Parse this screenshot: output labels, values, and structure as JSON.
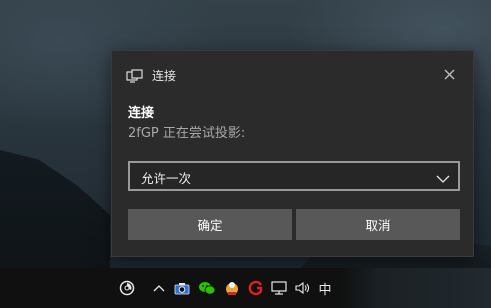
{
  "dialog": {
    "app_title": "连接",
    "heading": "连接",
    "subtext": "2fGP 正在尝试投影:",
    "select_value": "允许一次",
    "ok_label": "确定",
    "cancel_label": "取消",
    "icons": {
      "app": "cast-screen-icon",
      "close": "close-icon",
      "dropdown": "chevron-down-icon"
    }
  },
  "taskbar": {
    "ime_label": "中",
    "tray_icons": [
      "app-swirl-icon",
      "chevron-up-icon",
      "camera-icon",
      "wechat-icon",
      "taskbar-app-icon",
      "red-g-icon",
      "network-icon",
      "volume-icon"
    ]
  },
  "colors": {
    "dialog_bg": "#2b2b2b",
    "button_bg": "#585858",
    "taskbar_bg": "#101010",
    "wechat_green": "#2dc100",
    "red_icon": "#e02020"
  }
}
